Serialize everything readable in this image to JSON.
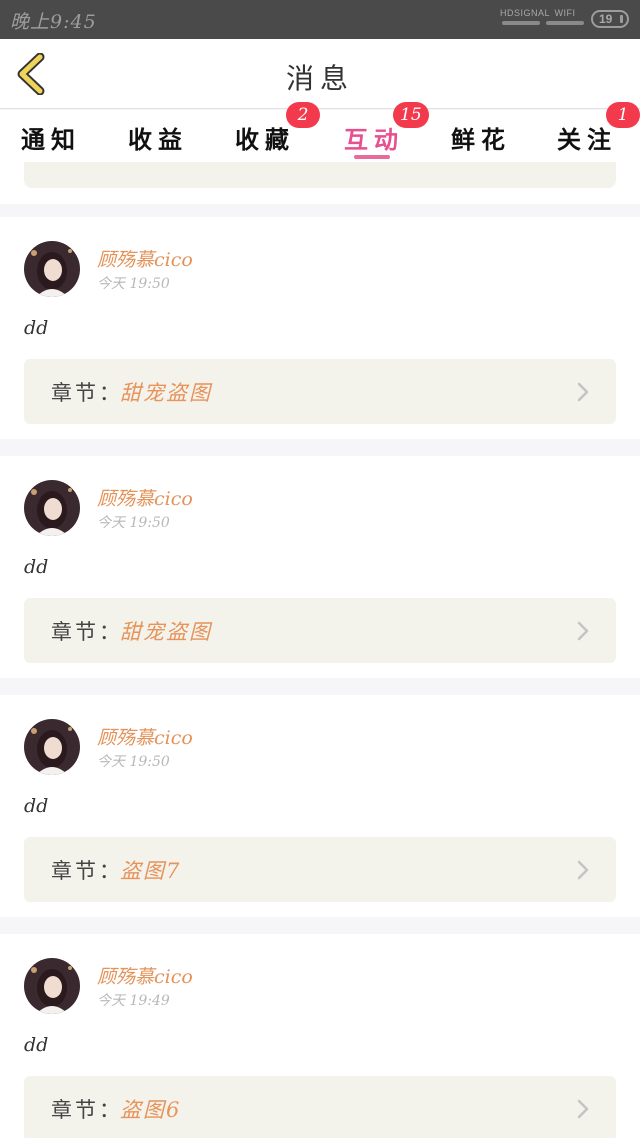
{
  "status_bar": {
    "time": "晚上9:45",
    "signal_label": "HD",
    "signal_label2": "SIGNAL",
    "wifi_label": "WIFI",
    "battery": "19",
    "icons": [
      "signal-icon",
      "wifi-icon",
      "battery-icon"
    ]
  },
  "header": {
    "title": "消息",
    "back_icon": "chevron-left-icon",
    "back_color": "#e8c94a"
  },
  "tabs": [
    {
      "label": "通知",
      "badge": ""
    },
    {
      "label": "收益",
      "badge": ""
    },
    {
      "label": "收藏",
      "badge": "2"
    },
    {
      "label": "互动",
      "badge": "15",
      "active": true
    },
    {
      "label": "鲜花",
      "badge": ""
    },
    {
      "label": "关注",
      "badge": "1"
    }
  ],
  "colors": {
    "accent": "#e84f8e",
    "badge": "#f23a4c",
    "author": "#e3935a",
    "chapter_box": "#f3f3ec"
  },
  "messages": [
    {
      "author": "顾殇慕cico",
      "time": "今天 19:50",
      "content": "dd",
      "chapter_label": "章节：",
      "chapter": "甜宠盗图"
    },
    {
      "author": "顾殇慕cico",
      "time": "今天 19:50",
      "content": "dd",
      "chapter_label": "章节：",
      "chapter": "甜宠盗图"
    },
    {
      "author": "顾殇慕cico",
      "time": "今天 19:50",
      "content": "dd",
      "chapter_label": "章节：",
      "chapter": "盗图7"
    },
    {
      "author": "顾殇慕cico",
      "time": "今天 19:49",
      "content": "dd",
      "chapter_label": "章节：",
      "chapter": "盗图6"
    }
  ]
}
